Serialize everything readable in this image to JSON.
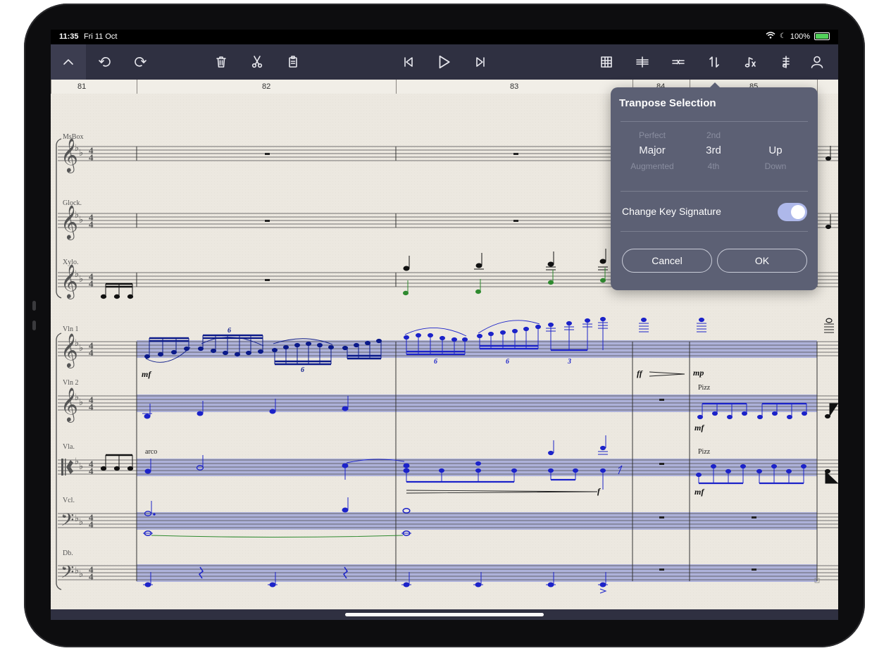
{
  "status_bar": {
    "time": "11:35",
    "date": "Fri 11 Oct",
    "battery": "100%"
  },
  "toolbar": {
    "left": [
      "chevron-up-icon",
      "undo-icon",
      "redo-icon"
    ],
    "edit": [
      "trash-icon",
      "scissors-icon",
      "paste-icon"
    ],
    "transport": [
      "skip-back-icon",
      "play-icon",
      "skip-forward-icon"
    ],
    "right": [
      "grid-select-icon",
      "split-staff-icon",
      "swap-icon",
      "transpose-icon",
      "note-input-icon",
      "tuner-icon",
      "account-icon"
    ]
  },
  "ruler": {
    "bars": [
      "81",
      "82",
      "83",
      "84",
      "85"
    ]
  },
  "instruments": [
    "MsBox",
    "Glock.",
    "Xylo.",
    "Vln 1",
    "Vln 2",
    "Vla.",
    "Vcl.",
    "Db."
  ],
  "score_marks": {
    "dyn_mf": "mf",
    "dyn_ff": "ff",
    "dyn_mp": "mp",
    "dyn_f": "f",
    "arco": "arco",
    "pizz": "Pizz",
    "tuplet6": "6",
    "tuplet3": "3",
    "time_sig": "4"
  },
  "colors": {
    "toolbar": "#2f3041",
    "selection": "#a7acd9",
    "note_blue": "#1c23c9",
    "note_green": "#2f8a2f",
    "popover": "#5c6074"
  },
  "popover": {
    "title": "Tranpose Selection",
    "quality": {
      "above": "Perfect",
      "selected": "Major",
      "below": "Augmented"
    },
    "interval": {
      "above": "2nd",
      "selected": "3rd",
      "below": "4th"
    },
    "direction": {
      "above": "",
      "selected": "Up",
      "below": "Down"
    },
    "toggle_label": "Change Key Signature",
    "toggle_on": true,
    "cancel_label": "Cancel",
    "ok_label": "OK"
  }
}
